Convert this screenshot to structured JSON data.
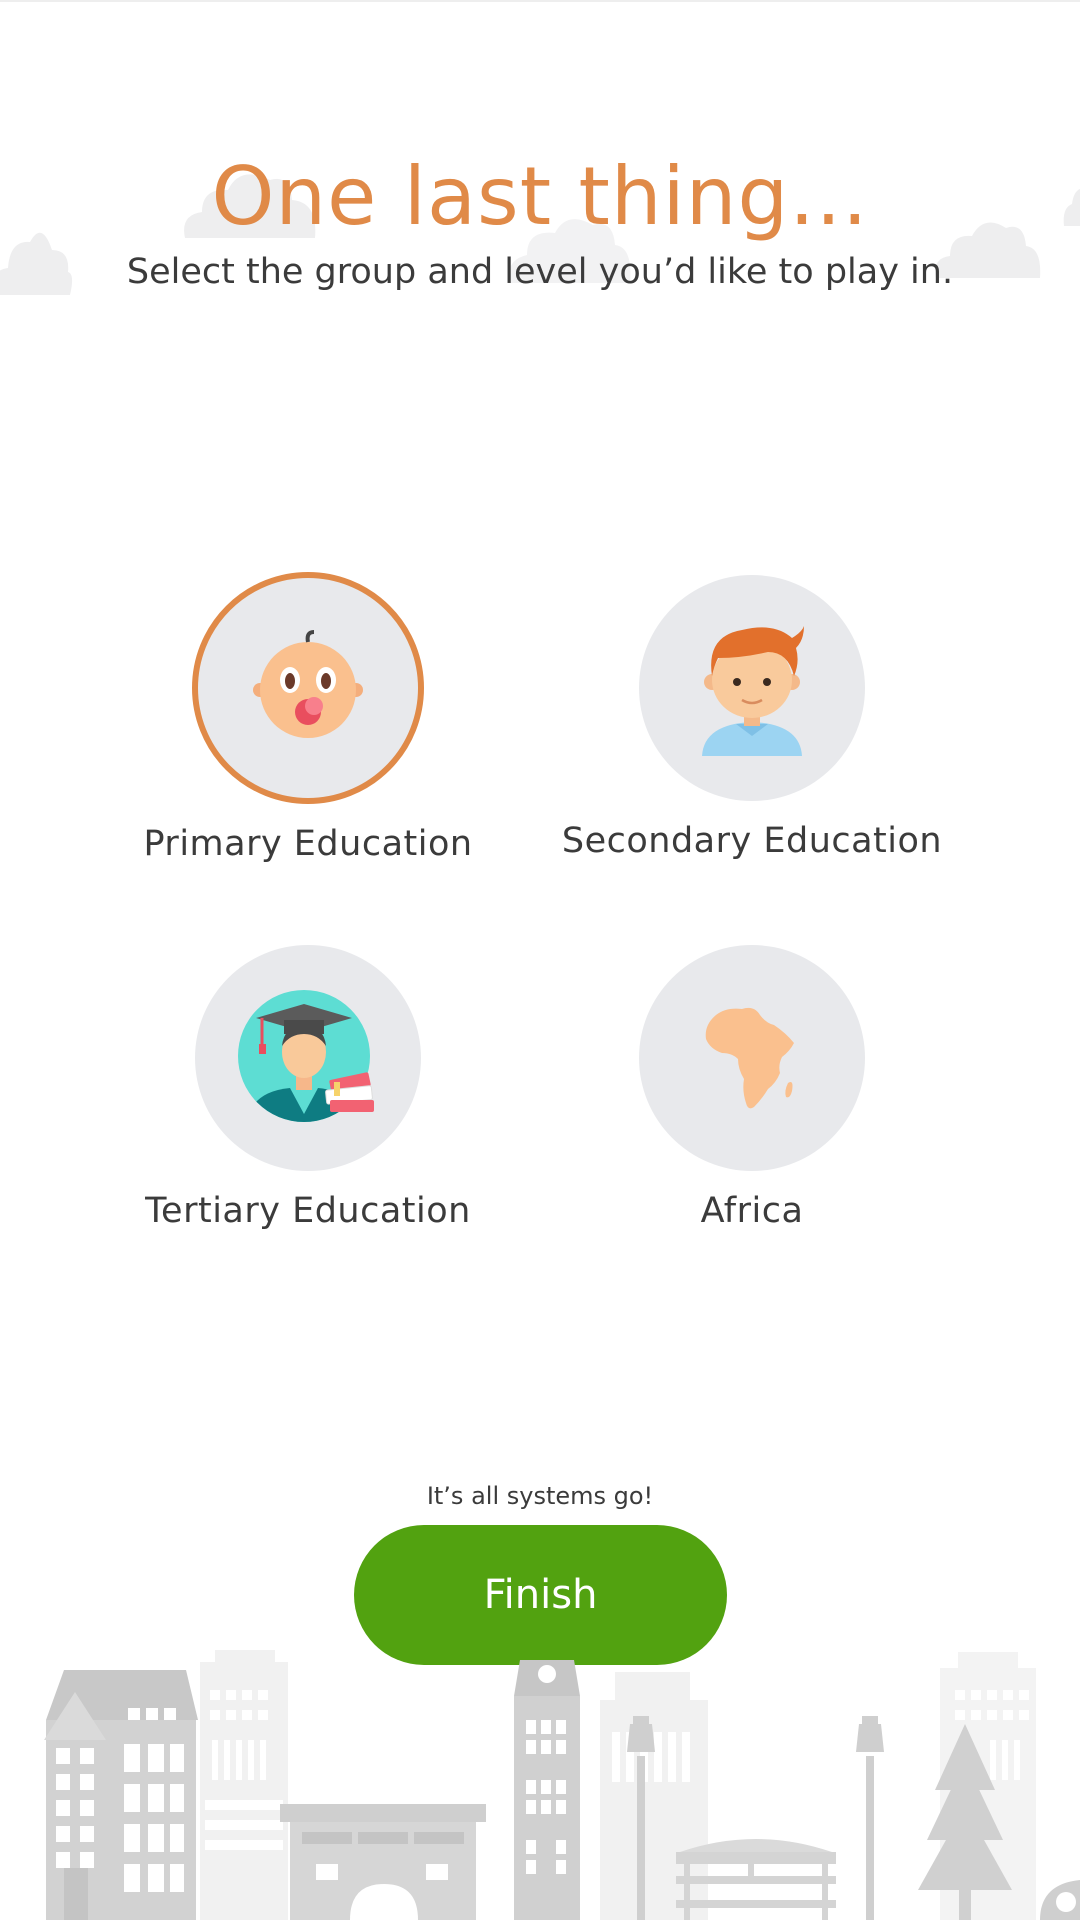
{
  "header": {
    "title": "One last thing...",
    "subtitle": "Select the group and level you’d like to play in."
  },
  "options": [
    {
      "label": "Primary Education",
      "icon": "baby-icon",
      "selected": true
    },
    {
      "label": "Secondary Education",
      "icon": "boy-icon",
      "selected": false
    },
    {
      "label": "Tertiary Education",
      "icon": "graduate-icon",
      "selected": false
    },
    {
      "label": "Africa",
      "icon": "africa-map-icon",
      "selected": false
    }
  ],
  "footer": {
    "status": "It’s all systems go!",
    "finish_label": "Finish"
  },
  "colors": {
    "accent": "#E08A48",
    "button": "#52A210",
    "circle": "#E8E9EC",
    "text": "#3b3b3b"
  }
}
